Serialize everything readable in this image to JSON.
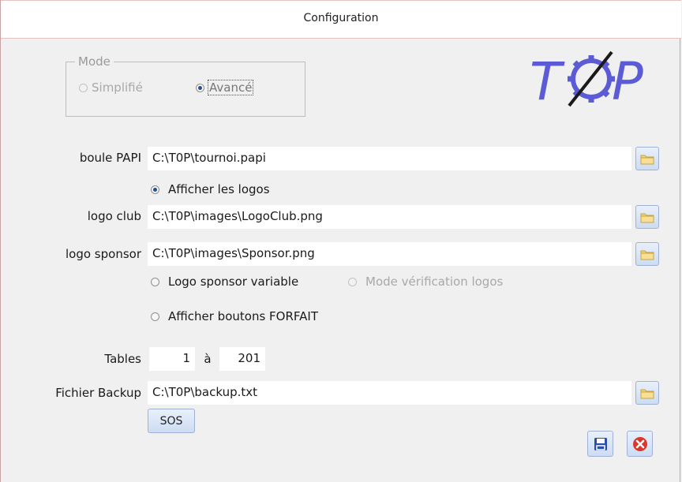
{
  "window": {
    "title": "Configuration"
  },
  "mode": {
    "legend": "Mode",
    "options": [
      {
        "label": "Simplifié",
        "selected": false
      },
      {
        "label": "Avancé",
        "selected": true
      }
    ]
  },
  "logo": {
    "text": "T0P",
    "color": "#5b5bd6"
  },
  "fields": {
    "boule_papi": {
      "label": "boule PAPI",
      "value": "C:\\T0P\\tournoi.papi"
    },
    "afficher_logos": {
      "label": "Afficher les logos",
      "checked": true
    },
    "logo_club": {
      "label": "logo club",
      "value": "C:\\T0P\\images\\LogoClub.png"
    },
    "logo_sponsor": {
      "label": "logo sponsor",
      "value": "C:\\T0P\\images\\Sponsor.png"
    },
    "logo_sponsor_variable": {
      "label": "Logo sponsor variable",
      "checked": false
    },
    "mode_verification": {
      "label": "Mode vérification logos",
      "checked": false,
      "disabled": true
    },
    "afficher_forfait": {
      "label": "Afficher boutons FORFAIT",
      "checked": false
    },
    "tables": {
      "label": "Tables",
      "from": "1",
      "separator": "à",
      "to": "201"
    },
    "fichier_backup": {
      "label": "Fichier Backup",
      "value": "C:\\T0P\\backup.txt"
    }
  },
  "buttons": {
    "sos": "SOS",
    "save_icon": "floppy-disk-icon",
    "cancel_icon": "close-circle-icon",
    "browse_icon": "folder-icon"
  },
  "colors": {
    "accent_blue": "#1f4f8f",
    "cancel_red": "#d9382b",
    "button_border": "#9fb2d6"
  }
}
